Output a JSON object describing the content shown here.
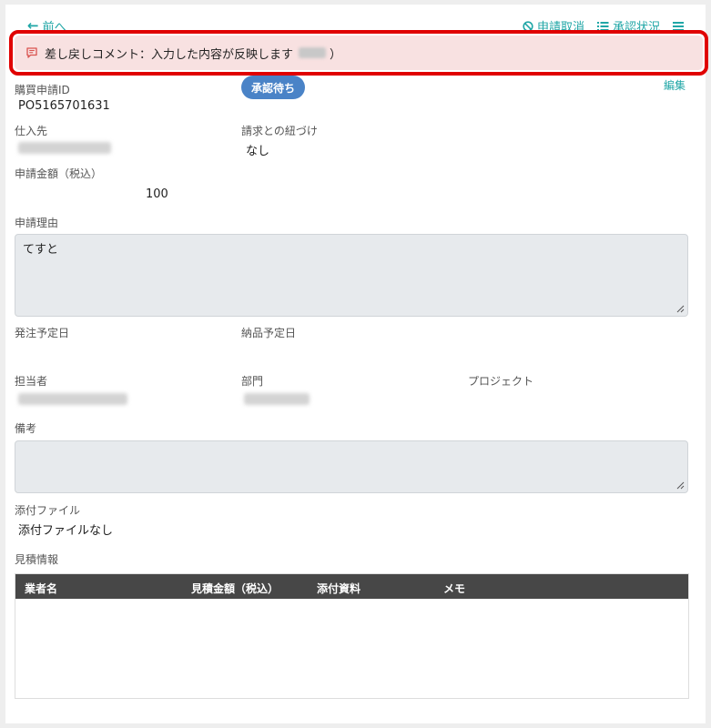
{
  "header": {
    "back_label": "前へ",
    "cancel_label": "申請取消",
    "status_label": "承認状況"
  },
  "alert": {
    "text": "差し戻しコメント：入力した内容が反映します",
    "suffix": "）"
  },
  "badge": "承認待ち",
  "edit_label": "編集",
  "fields": {
    "po_id_label": "購買申請ID",
    "po_id_value": "PO5165701631",
    "supplier_label": "仕入先",
    "invoice_link_label": "請求との紐づけ",
    "invoice_link_value": "なし",
    "amount_label": "申請金額（税込）",
    "amount_value": "100",
    "reason_label": "申請理由",
    "reason_value": "てすと",
    "order_date_label": "発注予定日",
    "delivery_date_label": "納品予定日",
    "person_label": "担当者",
    "department_label": "部門",
    "project_label": "プロジェクト",
    "remarks_label": "備考",
    "remarks_value": "",
    "attachments_label": "添付ファイル",
    "attachments_value": "添付ファイルなし",
    "quote_label": "見積情報"
  },
  "quote_table": {
    "columns": [
      "業者名",
      "見積金額（税込）",
      "添付資料",
      "メモ"
    ]
  },
  "colors": {
    "accent": "#1fa6a6",
    "badge": "#4a83c7",
    "alert_bg": "#f8e1e1",
    "highlight": "#e00000",
    "table_header": "#474747"
  }
}
